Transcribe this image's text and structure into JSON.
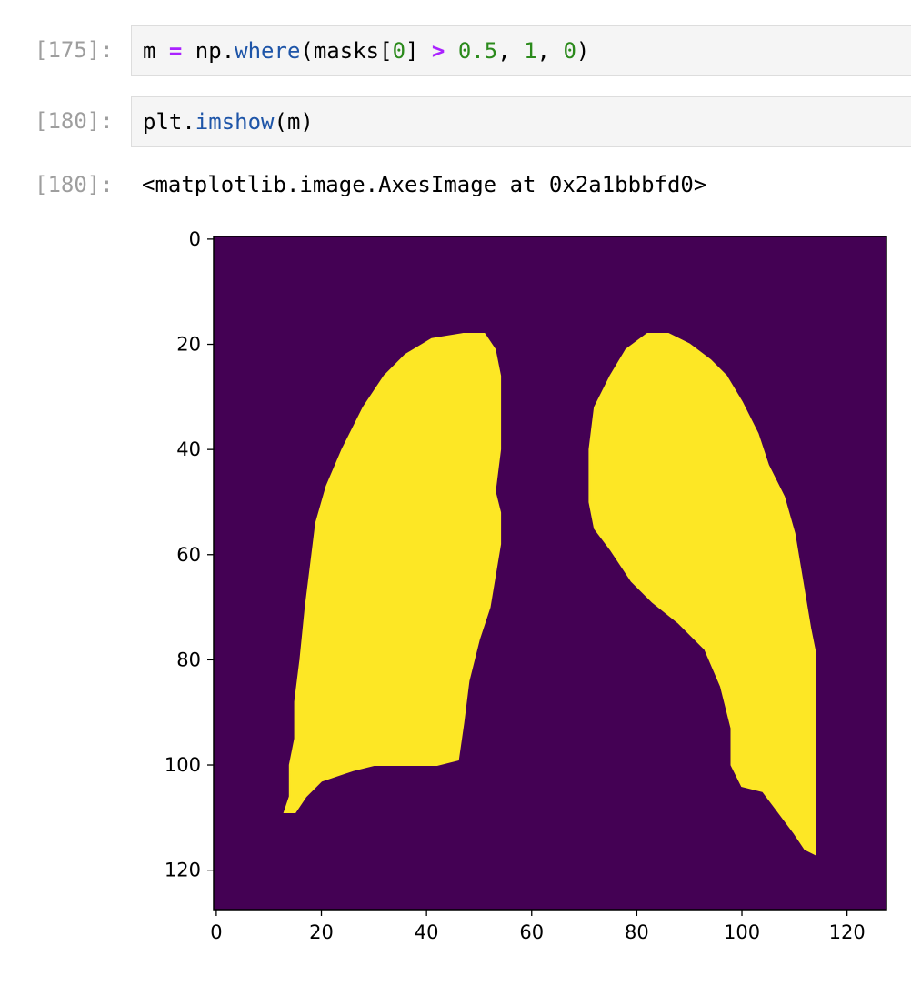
{
  "cells": [
    {
      "prompt": "[175]:",
      "tokens": [
        {
          "t": "m ",
          "c": "plain"
        },
        {
          "t": "=",
          "c": "kw"
        },
        {
          "t": " np.",
          "c": "plain"
        },
        {
          "t": "where",
          "c": "fn"
        },
        {
          "t": "(masks[",
          "c": "plain"
        },
        {
          "t": "0",
          "c": "num"
        },
        {
          "t": "] ",
          "c": "plain"
        },
        {
          "t": ">",
          "c": "kw"
        },
        {
          "t": " ",
          "c": "plain"
        },
        {
          "t": "0.5",
          "c": "num"
        },
        {
          "t": ", ",
          "c": "plain"
        },
        {
          "t": "1",
          "c": "num"
        },
        {
          "t": ", ",
          "c": "plain"
        },
        {
          "t": "0",
          "c": "num"
        },
        {
          "t": ")",
          "c": "plain"
        }
      ]
    },
    {
      "prompt": "[180]:",
      "tokens": [
        {
          "t": "plt.",
          "c": "plain"
        },
        {
          "t": "imshow",
          "c": "fn"
        },
        {
          "t": "(m)",
          "c": "plain"
        }
      ]
    }
  ],
  "output": {
    "prompt": "[180]:",
    "text": "<matplotlib.image.AxesImage at 0x2a1bbbfd0>"
  },
  "colors": {
    "background_value_0": "#440154",
    "mask_value_1": "#fde725"
  },
  "chart_data": {
    "type": "heatmap",
    "title": "",
    "xlabel": "",
    "ylabel": "",
    "xlim": [
      -0.5,
      127.5
    ],
    "ylim": [
      127.5,
      -0.5
    ],
    "xticks": [
      0,
      20,
      40,
      60,
      80,
      100,
      120
    ],
    "yticks": [
      0,
      20,
      40,
      60,
      80,
      100,
      120
    ],
    "grid": false,
    "colormap": "viridis",
    "values": [
      0,
      1
    ],
    "regions": [
      {
        "name": "left lung mask",
        "value": 1,
        "polygon_data_coords": [
          [
            47,
            18
          ],
          [
            51,
            18
          ],
          [
            53,
            21
          ],
          [
            54,
            26
          ],
          [
            54,
            40
          ],
          [
            53,
            48
          ],
          [
            54,
            52
          ],
          [
            54,
            58
          ],
          [
            53,
            64
          ],
          [
            52,
            70
          ],
          [
            50,
            76
          ],
          [
            48,
            84
          ],
          [
            47,
            92
          ],
          [
            46,
            99
          ],
          [
            42,
            100
          ],
          [
            33,
            100
          ],
          [
            30,
            100
          ],
          [
            26,
            101
          ],
          [
            20,
            103
          ],
          [
            17,
            106
          ],
          [
            15,
            109
          ],
          [
            13,
            109
          ],
          [
            14,
            106
          ],
          [
            14,
            100
          ],
          [
            15,
            95
          ],
          [
            15,
            88
          ],
          [
            16,
            80
          ],
          [
            17,
            70
          ],
          [
            18,
            62
          ],
          [
            19,
            54
          ],
          [
            21,
            47
          ],
          [
            24,
            40
          ],
          [
            28,
            32
          ],
          [
            32,
            26
          ],
          [
            36,
            22
          ],
          [
            41,
            19
          ]
        ]
      },
      {
        "name": "right lung mask",
        "value": 1,
        "polygon_data_coords": [
          [
            82,
            18
          ],
          [
            86,
            18
          ],
          [
            90,
            20
          ],
          [
            94,
            23
          ],
          [
            97,
            26
          ],
          [
            100,
            31
          ],
          [
            103,
            37
          ],
          [
            105,
            43
          ],
          [
            108,
            49
          ],
          [
            110,
            56
          ],
          [
            111,
            62
          ],
          [
            112,
            68
          ],
          [
            113,
            74
          ],
          [
            114,
            79
          ],
          [
            114,
            100
          ],
          [
            114,
            110
          ],
          [
            114,
            117
          ],
          [
            112,
            116
          ],
          [
            110,
            113
          ],
          [
            107,
            109
          ],
          [
            104,
            105
          ],
          [
            100,
            104
          ],
          [
            98,
            100
          ],
          [
            98,
            93
          ],
          [
            96,
            85
          ],
          [
            93,
            78
          ],
          [
            88,
            73
          ],
          [
            83,
            69
          ],
          [
            79,
            65
          ],
          [
            75,
            59
          ],
          [
            72,
            55
          ],
          [
            71,
            50
          ],
          [
            71,
            40
          ],
          [
            72,
            32
          ],
          [
            75,
            26
          ],
          [
            78,
            21
          ]
        ]
      }
    ]
  }
}
